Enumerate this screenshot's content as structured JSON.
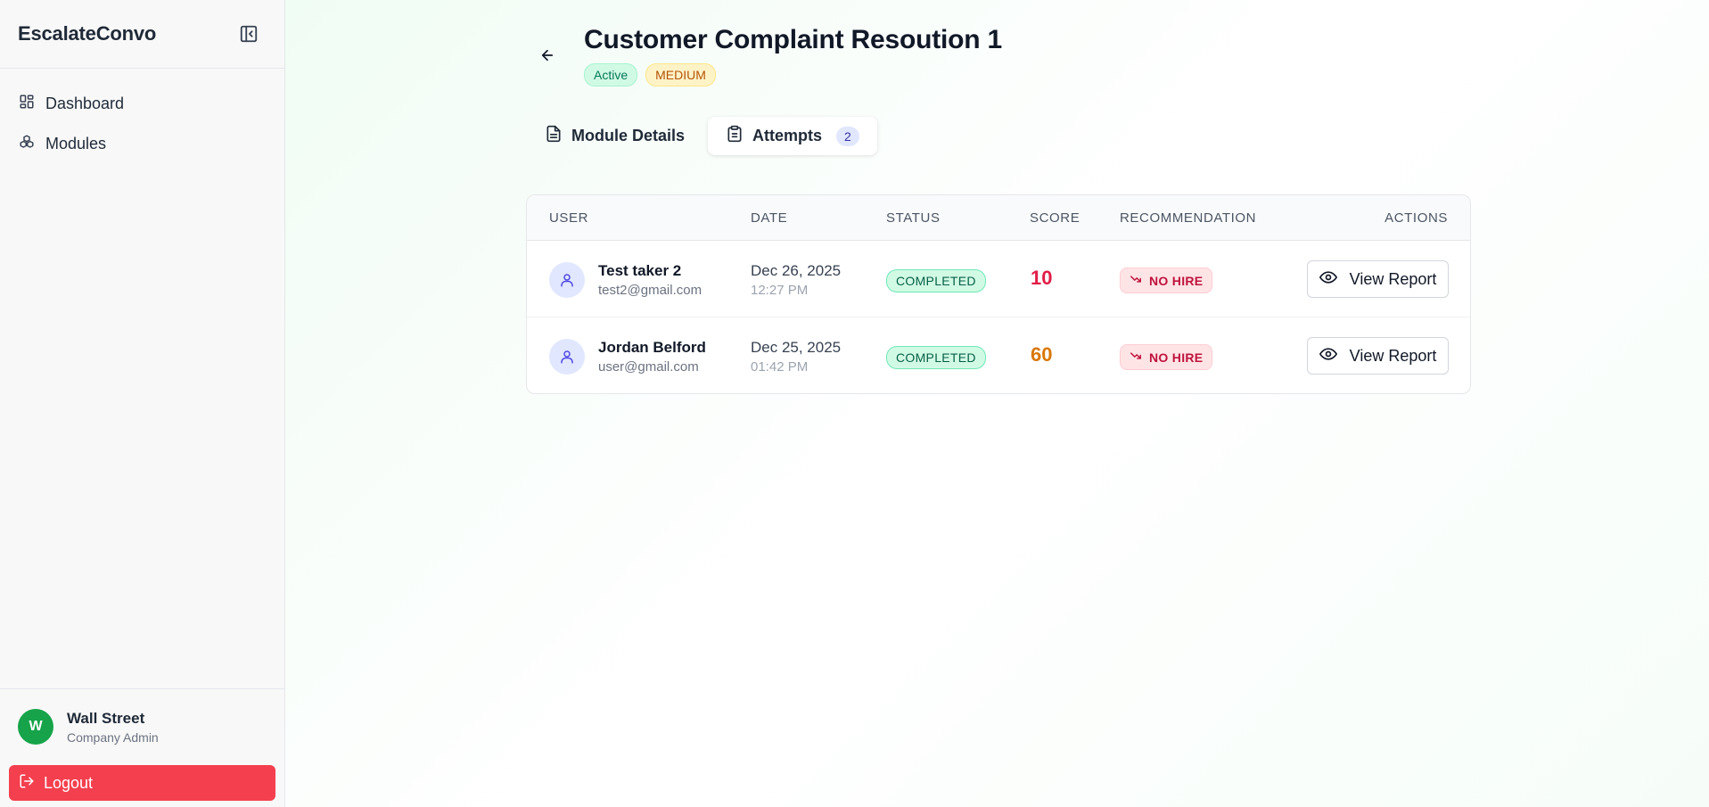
{
  "sidebar": {
    "brand": "EscalateConvo",
    "items": [
      {
        "label": "Dashboard",
        "icon": "dashboard-icon"
      },
      {
        "label": "Modules",
        "icon": "modules-icon"
      }
    ],
    "profile": {
      "initial": "W",
      "name": "Wall Street",
      "role": "Company Admin"
    },
    "logout_label": "Logout"
  },
  "header": {
    "title": "Customer Complaint Resoution 1",
    "status_badge": "Active",
    "difficulty_badge": "MEDIUM"
  },
  "tabs": [
    {
      "label": "Module Details",
      "icon": "document-icon",
      "active": false
    },
    {
      "label": "Attempts",
      "icon": "clipboard-icon",
      "active": true,
      "count": "2"
    }
  ],
  "table": {
    "columns": [
      "USER",
      "DATE",
      "STATUS",
      "SCORE",
      "RECOMMENDATION",
      "ACTIONS"
    ],
    "rows": [
      {
        "name": "Test taker 2",
        "email": "test2@gmail.com",
        "date": "Dec 26, 2025",
        "time": "12:27 PM",
        "status": "COMPLETED",
        "score": "10",
        "score_color": "#e11d48",
        "recommendation": "NO HIRE",
        "action": "View Report"
      },
      {
        "name": "Jordan Belford",
        "email": "user@gmail.com",
        "date": "Dec 25, 2025",
        "time": "01:42 PM",
        "status": "COMPLETED",
        "score": "60",
        "score_color": "#d97706",
        "recommendation": "NO HIRE",
        "action": "View Report"
      }
    ]
  },
  "colors": {
    "accent_green": "#16a34a",
    "logout_red": "#f43f4e"
  }
}
